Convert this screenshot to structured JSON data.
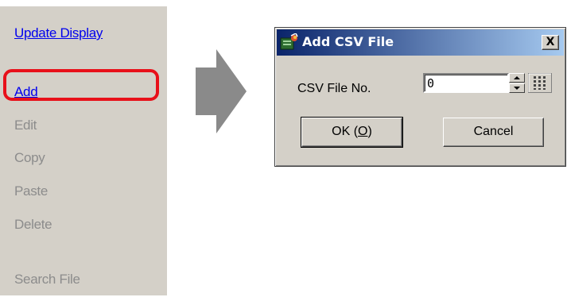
{
  "menu": {
    "items": [
      {
        "label": "Update Display",
        "state": "link"
      },
      {
        "label": "Add",
        "state": "link"
      },
      {
        "label": "Edit",
        "state": "disabled"
      },
      {
        "label": "Copy",
        "state": "disabled"
      },
      {
        "label": "Paste",
        "state": "disabled"
      },
      {
        "label": "Delete",
        "state": "disabled"
      },
      {
        "label": "Search File",
        "state": "disabled"
      }
    ],
    "highlighted_item": "Add"
  },
  "dialog": {
    "title": "Add CSV File",
    "close_label": "X",
    "field_label": "CSV File No.",
    "field_value": "0",
    "ok_label": "OK (O)",
    "ok_mnemonic": "O",
    "cancel_label": "Cancel"
  },
  "colors": {
    "highlight": "#e8101a",
    "link": "#0000ee",
    "disabled": "#8c8c8c",
    "title_bar_start": "#0a246a",
    "title_bar_end": "#a6caf0"
  }
}
